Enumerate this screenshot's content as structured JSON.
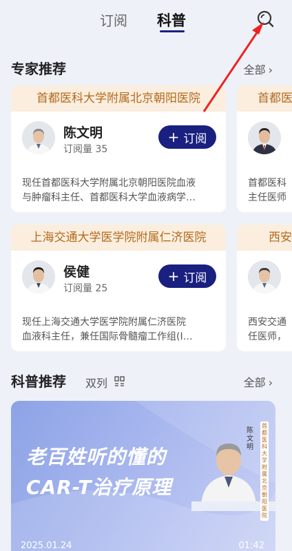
{
  "tabs": {
    "subscribe": "订阅",
    "science": "科普"
  },
  "experts_section": {
    "title": "专家推荐",
    "more": "全部"
  },
  "experts": [
    {
      "hospital": "首都医科大学附属北京朝阳医院",
      "name": "陈文明",
      "subs": "订阅量 35",
      "button": "订阅",
      "desc_line1": "现任首都医科大学附属北京朝阳医院血液",
      "desc_line2": "与肿瘤科主任、首都医科大学血液病学…"
    },
    {
      "hospital": "首都医",
      "name": "",
      "subs": "",
      "button": "",
      "desc_line1": "首都医科",
      "desc_line2": "主任医师"
    },
    {
      "hospital": "上海交通大学医学院附属仁济医院",
      "name": "侯健",
      "subs": "订阅量 25",
      "button": "订阅",
      "desc_line1": "现任上海交通大学医学院附属仁济医院",
      "desc_line2": "血液科主任，兼任国际骨髓瘤工作组(I…"
    },
    {
      "hospital": "西安",
      "name": "",
      "subs": "",
      "button": "",
      "desc_line1": "西安交通",
      "desc_line2": "任医师，"
    }
  ],
  "science_section": {
    "title": "科普推荐",
    "dual": "双列",
    "more": "全部"
  },
  "video": {
    "title_line1": "老百姓听的懂的",
    "title_line2": "CAR-T治疗原理",
    "doctor_name": "陈文明",
    "doctor_hospital": "首都医科大学附属北京朝阳医院",
    "date": "2025.01.24",
    "duration": "01:42"
  },
  "colors": {
    "accent": "#1a2080",
    "hospital_bg": "#fbeede",
    "hospital_text": "#b26a1e",
    "arrow": "#ee2222"
  }
}
